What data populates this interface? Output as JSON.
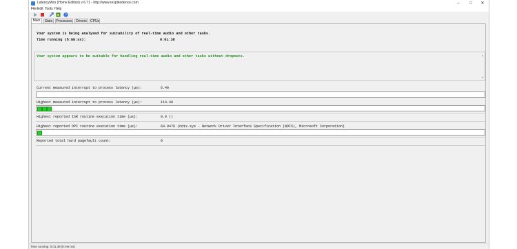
{
  "window": {
    "title": "LatencyMon (Home Edition)  v 6.71 - http://www.resplendence.com",
    "minimize_glyph": "–",
    "maximize_glyph": "□",
    "close_glyph": "✕"
  },
  "menu": [
    "File",
    "Edit",
    "Tools",
    "Help"
  ],
  "toolbar": {
    "buttons": [
      "play-icon",
      "stop-icon",
      "tools-icon",
      "report-icon",
      "help-icon"
    ],
    "colors": {
      "play": "#9aa4b0",
      "stop": "#d42a2a",
      "tools": "#3a6fc4",
      "report": "#2b8a3e",
      "help": "#2f6fd8"
    }
  },
  "tabs": [
    "Main",
    "Stats",
    "Processes",
    "Drivers",
    "CPUs"
  ],
  "header": {
    "analysis_text": "Your system is being analysed for suitability of real-time audio and other tasks.",
    "time_label": "Time running (h:mm:ss):",
    "time_value": "0:01:38"
  },
  "verdict": {
    "text": "Your system appears to be suitable for handling real-time audio and other tasks without dropouts.",
    "color": "#1e8c1e"
  },
  "metrics": [
    {
      "label": "Current measured interrupt to process latency (µs):",
      "value": "6.40",
      "bar_segments": 0
    },
    {
      "label": "Highest measured interrupt to process latency (µs):",
      "value": "114.40",
      "bar_segments": 3
    },
    {
      "label": "Highest reported ISR routine execution time (µs):",
      "value": "0.0   ()"
    },
    {
      "label": "Highest reported DPC routine execution time (µs):",
      "value": "64.0470   (ndis.sys - Network Driver Interface Specification (NDIS), Microsoft Corporation)",
      "bar_segments": 1
    },
    {
      "label": "Reported total hard pagefault count:",
      "value": "0"
    }
  ],
  "status": {
    "text": "Time running: 0:01:38  (h:mm:ss)"
  }
}
